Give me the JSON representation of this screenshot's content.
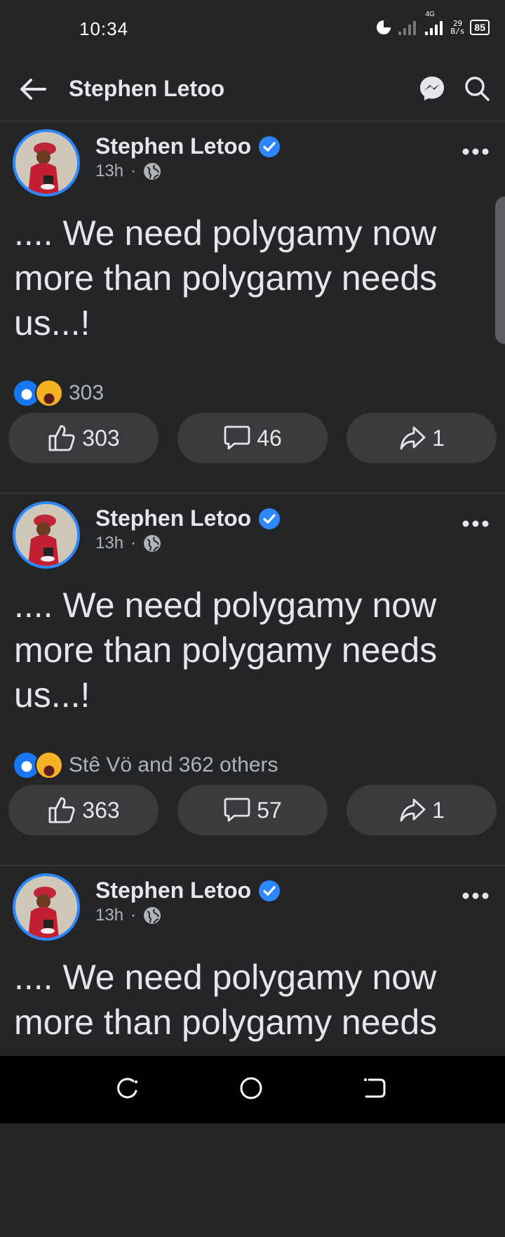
{
  "status_bar": {
    "time": "10:34",
    "network": "4G",
    "speed_value": "29",
    "speed_unit": "B/s",
    "battery": "85"
  },
  "header": {
    "title": "Stephen Letoo"
  },
  "posts": [
    {
      "author": "Stephen Letoo",
      "time": "13h",
      "separator": "·",
      "text": ".... We need polygamy now more than polygamy needs us...!",
      "reactions_summary": "303",
      "like_count": "303",
      "comment_count": "46",
      "share_count": "1"
    },
    {
      "author": "Stephen Letoo",
      "time": "13h",
      "separator": "·",
      "text": ".... We need polygamy now more than polygamy needs us...!",
      "reactions_summary": "Stê Vö and 362 others",
      "like_count": "363",
      "comment_count": "57",
      "share_count": "1"
    },
    {
      "author": "Stephen Letoo",
      "time": "13h",
      "separator": "·",
      "text": ".... We need polygamy now more than polygamy needs",
      "reactions_summary": "",
      "like_count": "",
      "comment_count": "",
      "share_count": ""
    }
  ],
  "icons": {
    "back": "arrow-left-icon",
    "messenger": "messenger-icon",
    "search": "search-icon",
    "verified": "verified-badge-icon",
    "privacy": "globe-icon",
    "more": "more-icon",
    "like": "like-icon",
    "comment": "comment-icon",
    "share": "share-icon"
  },
  "colors": {
    "background": "#242526",
    "accent": "#2d88ff",
    "text": "#e4e6eb",
    "secondary_text": "#b0b3b8",
    "button": "#3a3b3c"
  }
}
